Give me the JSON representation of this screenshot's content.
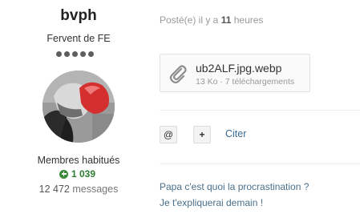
{
  "author": {
    "username": "bvph",
    "rank_title": "Fervent de FE",
    "rank_pips": 5,
    "group": "Membres habitués",
    "reputation": "1 039",
    "posts_number": "12 472",
    "posts_label": "messages",
    "avatar_icon": "avatar-photo"
  },
  "post": {
    "meta_prefix": "Posté(e) il y a",
    "meta_number": "11",
    "meta_suffix": "heures"
  },
  "attachment": {
    "icon": "paperclip-icon",
    "filename": "ub2ALF.jpg.webp",
    "info": "13 Ko · 7 téléchargements"
  },
  "actions": {
    "mention_symbol": "@",
    "multiquote_symbol": "+",
    "quote_label": "Citer"
  },
  "signature": {
    "line1": "Papa c'est quoi la procrastination ?",
    "line2": "Je t'expliquerai demain !"
  },
  "colors": {
    "reputation_green": "#3a8a3a",
    "link_blue": "#3a6c95",
    "signature_blue": "#4a6f8a"
  }
}
